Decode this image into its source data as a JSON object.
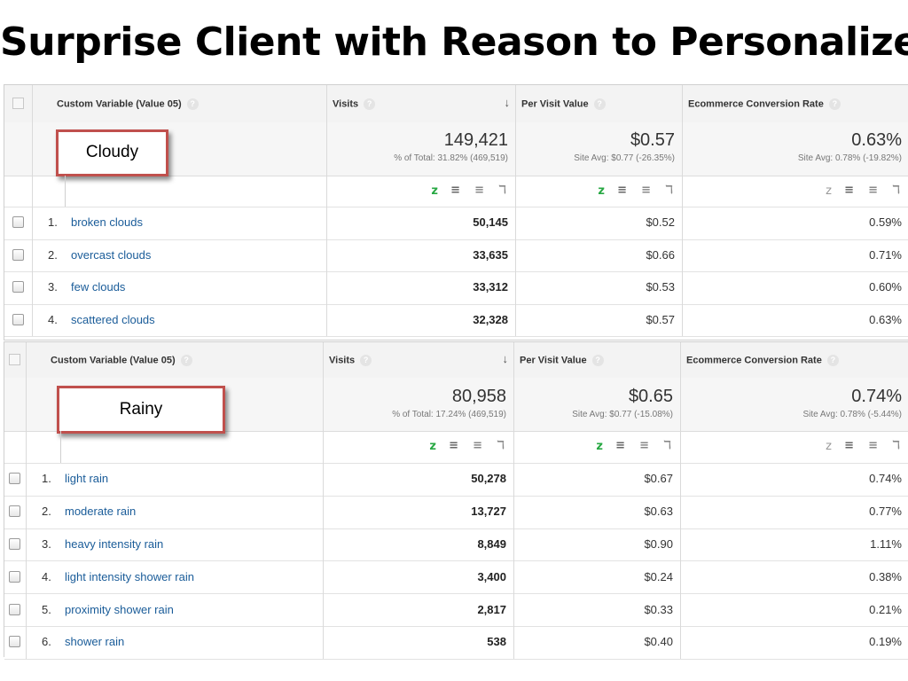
{
  "slide": {
    "title": "Surprise Client with Reason to Personalize"
  },
  "columns": {
    "dimension": "Custom Variable (Value 05)",
    "visits": "Visits",
    "per_visit_value": "Per Visit Value",
    "conversion_rate": "Ecommerce Conversion Rate",
    "help_glyph": "?",
    "sort_glyph": "↓"
  },
  "view_toggle_icons": [
    "z",
    "≡",
    "≡",
    "ℸ"
  ],
  "table1": {
    "callout": "Cloudy",
    "summary": {
      "visits": "149,421",
      "visits_sub": "% of Total: 31.82% (469,519)",
      "pvv": "$0.57",
      "pvv_sub": "Site Avg: $0.77 (-26.35%)",
      "conv": "0.63%",
      "conv_sub": "Site Avg: 0.78% (-19.82%)"
    },
    "rows": [
      {
        "index": "1.",
        "label": "broken clouds",
        "visits": "50,145",
        "pvv": "$0.52",
        "conv": "0.59%"
      },
      {
        "index": "2.",
        "label": "overcast clouds",
        "visits": "33,635",
        "pvv": "$0.66",
        "conv": "0.71%"
      },
      {
        "index": "3.",
        "label": "few clouds",
        "visits": "33,312",
        "pvv": "$0.53",
        "conv": "0.60%"
      },
      {
        "index": "4.",
        "label": "scattered clouds",
        "visits": "32,328",
        "pvv": "$0.57",
        "conv": "0.63%"
      }
    ]
  },
  "table2": {
    "callout": "Rainy",
    "summary": {
      "visits": "80,958",
      "visits_sub": "% of Total: 17.24% (469,519)",
      "pvv": "$0.65",
      "pvv_sub": "Site Avg: $0.77 (-15.08%)",
      "conv": "0.74%",
      "conv_sub": "Site Avg: 0.78% (-5.44%)"
    },
    "rows": [
      {
        "index": "1.",
        "label": "light rain",
        "visits": "50,278",
        "pvv": "$0.67",
        "conv": "0.74%"
      },
      {
        "index": "2.",
        "label": "moderate rain",
        "visits": "13,727",
        "pvv": "$0.63",
        "conv": "0.77%"
      },
      {
        "index": "3.",
        "label": "heavy intensity rain",
        "visits": "8,849",
        "pvv": "$0.90",
        "conv": "1.11%"
      },
      {
        "index": "4.",
        "label": "light intensity shower rain",
        "visits": "3,400",
        "pvv": "$0.24",
        "conv": "0.38%"
      },
      {
        "index": "5.",
        "label": "proximity shower rain",
        "visits": "2,817",
        "pvv": "$0.33",
        "conv": "0.21%"
      },
      {
        "index": "6.",
        "label": "shower rain",
        "visits": "538",
        "pvv": "$0.40",
        "conv": "0.19%"
      }
    ]
  },
  "colors": {
    "callout_border": "#c0504d",
    "link": "#1a5c99",
    "icon_active_green": "#27a843",
    "icon_gray": "#777777"
  }
}
